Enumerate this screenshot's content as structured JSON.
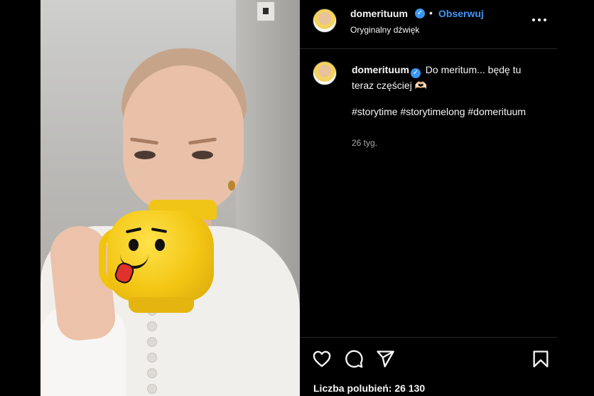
{
  "post": {
    "username": "domerituum",
    "verified_mark": "✓",
    "separator": "•",
    "follow_label": "Obserwuj",
    "audio_label": "Oryginalny dźwięk",
    "more_icon": "more-horizontal-icon"
  },
  "caption": {
    "username": "domerituum",
    "text": "Do meritum... będę tu teraz częściej 🫶🏻",
    "hashtags": "#storytime #storytimelong #domerituum",
    "time": "26 tyg."
  },
  "actions": {
    "like_icon": "heart-icon",
    "comment_icon": "comment-icon",
    "share_icon": "send-icon",
    "save_icon": "bookmark-icon",
    "likes_label": "Liczba polubień: 26 130"
  },
  "colors": {
    "background": "#000000",
    "text": "#f5f5f5",
    "link_blue": "#3f96f4",
    "verified_blue": "#3897f0",
    "muted": "#a8a8a8",
    "mug_yellow": "#f3c614"
  }
}
